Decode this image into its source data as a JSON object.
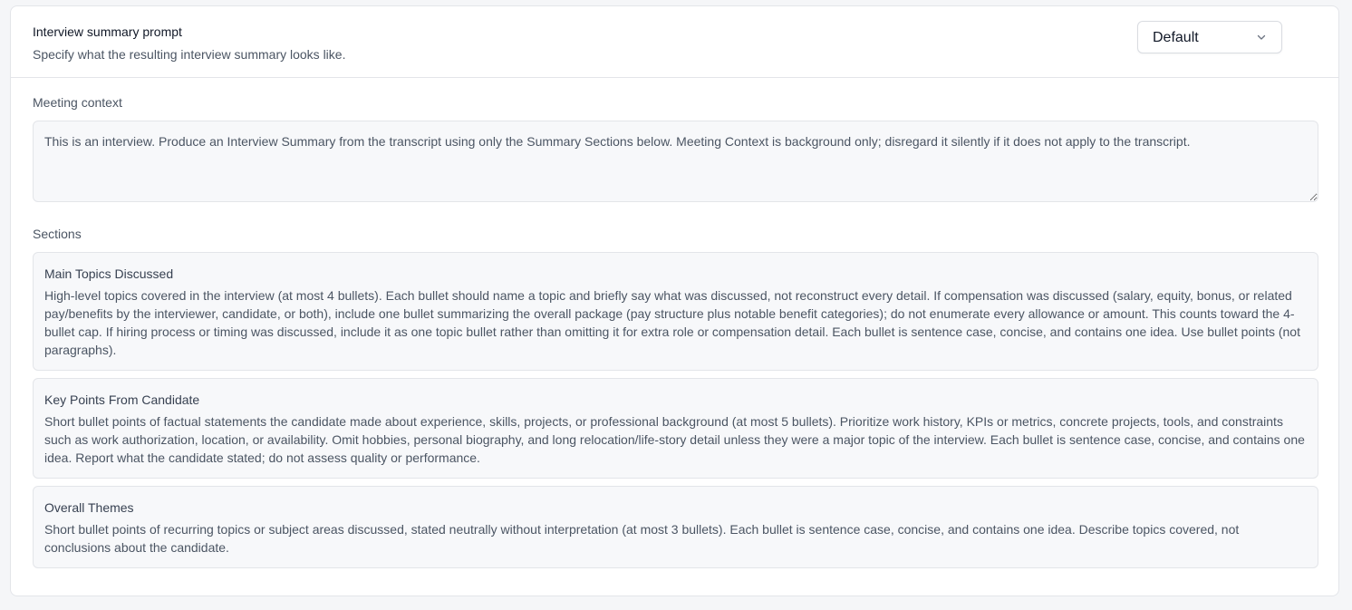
{
  "header": {
    "title": "Interview summary prompt",
    "subtitle": "Specify what the resulting interview summary looks like.",
    "template_select": {
      "value": "Default"
    }
  },
  "meeting_context": {
    "label": "Meeting context",
    "value": "This is an interview. Produce an Interview Summary from the transcript using only the Summary Sections below. Meeting Context is background only; disregard it silently if it does not apply to the transcript."
  },
  "sections": {
    "label": "Sections",
    "items": [
      {
        "title": "Main Topics Discussed",
        "body": "High-level topics covered in the interview (at most 4 bullets). Each bullet should name a topic and briefly say what was discussed, not reconstruct every detail. If compensation was discussed (salary, equity, bonus, or related pay/benefits by the interviewer, candidate, or both), include one bullet summarizing the overall package (pay structure plus notable benefit categories); do not enumerate every allowance or amount. This counts toward the 4-bullet cap. If hiring process or timing was discussed, include it as one topic bullet rather than omitting it for extra role or compensation detail. Each bullet is sentence case, concise, and contains one idea. Use bullet points (not paragraphs)."
      },
      {
        "title": "Key Points From Candidate",
        "body": "Short bullet points of factual statements the candidate made about experience, skills, projects, or professional background (at most 5 bullets). Prioritize work history, KPIs or metrics, concrete projects, tools, and constraints such as work authorization, location, or availability. Omit hobbies, personal biography, and long relocation/life-story detail unless they were a major topic of the interview. Each bullet is sentence case, concise, and contains one idea. Report what the candidate stated; do not assess quality or performance."
      },
      {
        "title": "Overall Themes",
        "body": "Short bullet points of recurring topics or subject areas discussed, stated neutrally without interpretation (at most 3 bullets). Each bullet is sentence case, concise, and contains one idea. Describe topics covered, not conclusions about the candidate."
      }
    ]
  },
  "icons": {
    "select_chevron": "chevron-down-icon"
  },
  "colors": {
    "background": "#f5f6f8",
    "card": "#ffffff",
    "border": "#e3e5e9",
    "field_background": "#f7f8fa",
    "text_primary": "#111827",
    "text_secondary": "#4b5563"
  }
}
